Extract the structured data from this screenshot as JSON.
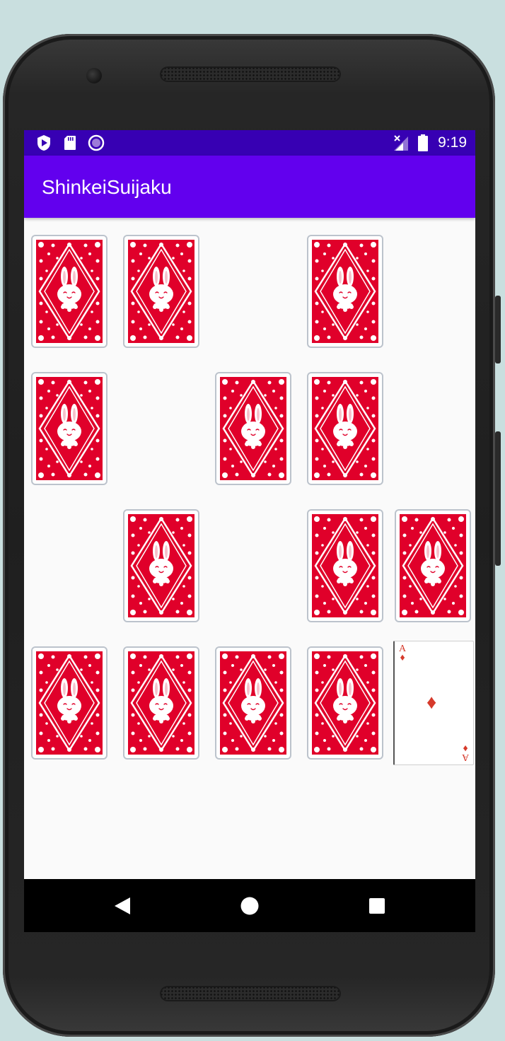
{
  "status_bar": {
    "time": "9:19",
    "left_icons": [
      "shield-play-icon",
      "sd-card-icon",
      "record-icon"
    ],
    "right_icons": [
      "signal-off-icon",
      "battery-icon"
    ]
  },
  "app_bar": {
    "title": "ShinkeiSuijaku"
  },
  "face_card": {
    "rank": "A",
    "suit_symbol": "♦",
    "suit": "diamonds",
    "color": "#d63a2b"
  },
  "nav_bar": {
    "icons": [
      "back-icon",
      "home-icon",
      "recents-icon"
    ]
  },
  "colors": {
    "status_bar": "#3700b3",
    "app_bar": "#6200ee",
    "card_back": "#e0002a"
  }
}
